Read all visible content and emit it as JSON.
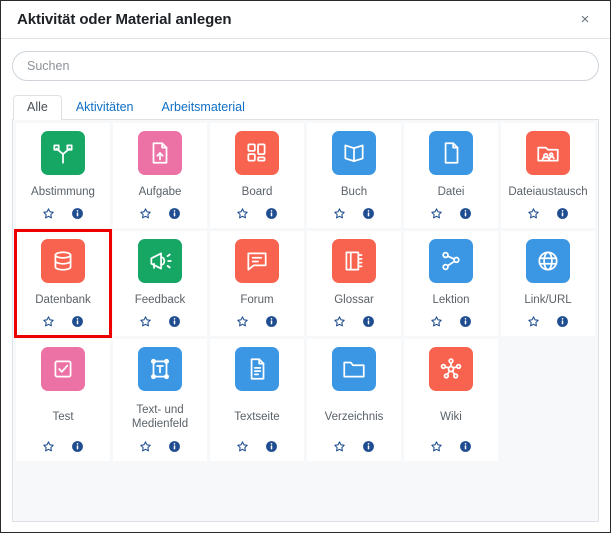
{
  "dialog": {
    "title": "Aktivität oder Material anlegen",
    "close_label": "×",
    "close_icon": "close-icon"
  },
  "search": {
    "placeholder": "Suchen",
    "value": ""
  },
  "tabs": [
    {
      "label": "Alle",
      "active": true
    },
    {
      "label": "Aktivitäten",
      "active": false
    },
    {
      "label": "Arbeitsmaterial",
      "active": false
    }
  ],
  "actions": {
    "favourite_icon": "star-outline-icon",
    "info_icon": "info-circle-icon"
  },
  "colors": {
    "green": "#16a765",
    "pink": "#ec72a6",
    "orange": "#f7634f",
    "blue": "#3b97e3",
    "highlight": "#ee0000",
    "tab_link": "#0f6fc5",
    "panel_bg": "#f7f8f9",
    "card_bg": "#ffffff",
    "label_text": "#5b6268",
    "action_icon": "#1f4d8f"
  },
  "items": [
    {
      "label": "Abstimmung",
      "color": "green",
      "icon": "choice-icon"
    },
    {
      "label": "Aufgabe",
      "color": "pink",
      "icon": "assignment-icon"
    },
    {
      "label": "Board",
      "color": "orange",
      "icon": "board-icon"
    },
    {
      "label": "Buch",
      "color": "blue",
      "icon": "book-icon"
    },
    {
      "label": "Datei",
      "color": "blue",
      "icon": "file-icon"
    },
    {
      "label": "Dateiaustausch",
      "color": "orange",
      "icon": "file-exchange-icon"
    },
    {
      "label": "Datenbank",
      "color": "orange",
      "icon": "database-icon",
      "highlighted": true
    },
    {
      "label": "Feedback",
      "color": "green",
      "icon": "megaphone-icon"
    },
    {
      "label": "Forum",
      "color": "orange",
      "icon": "forum-icon"
    },
    {
      "label": "Glossar",
      "color": "orange",
      "icon": "glossary-icon"
    },
    {
      "label": "Lektion",
      "color": "blue",
      "icon": "lesson-icon"
    },
    {
      "label": "Link/URL",
      "color": "blue",
      "icon": "globe-icon"
    },
    {
      "label": "Test",
      "color": "pink",
      "icon": "quiz-icon"
    },
    {
      "label": "Text- und Medienfeld",
      "color": "blue",
      "icon": "text-media-icon"
    },
    {
      "label": "Textseite",
      "color": "blue",
      "icon": "page-icon"
    },
    {
      "label": "Verzeichnis",
      "color": "blue",
      "icon": "folder-icon"
    },
    {
      "label": "Wiki",
      "color": "orange",
      "icon": "wiki-icon"
    }
  ]
}
